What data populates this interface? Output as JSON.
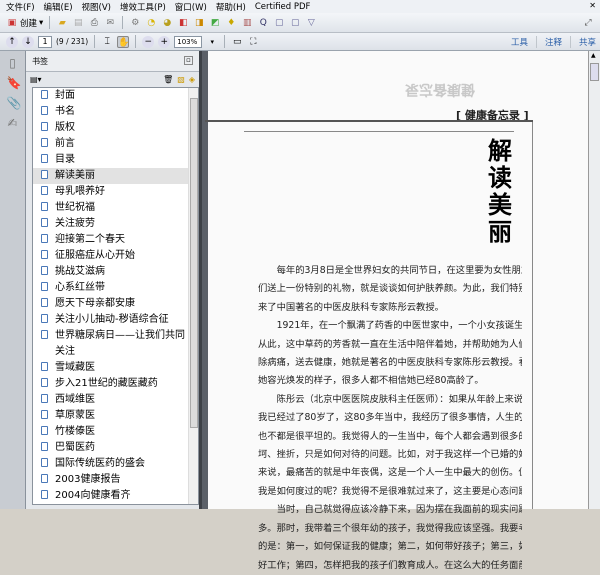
{
  "menu": [
    "文件(F)",
    "编辑(E)",
    "视图(V)",
    "增效工具(P)",
    "窗口(W)",
    "帮助(H)",
    "Certified PDF"
  ],
  "toolbar": {
    "create_label": "创建",
    "page_current": "1",
    "page_count": "(9 / 231)",
    "zoom": "103%",
    "links": [
      "工具",
      "注释",
      "共享"
    ]
  },
  "panel": {
    "title": "书签"
  },
  "bookmarks": [
    "封面",
    "书名",
    "版权",
    "前言",
    "目录",
    "解读美丽",
    "母乳喂养好",
    "世纪祝福",
    "关注疲劳",
    "迎接第二个春天",
    "征服癌症从心开始",
    "挑战艾滋病",
    "心系红丝带",
    "愿天下母亲都安康",
    "关注小儿抽动-秽语综合征",
    "世界糖尿病日——让我们共同关注",
    "雪域藏医",
    "步入21世纪的藏医藏药",
    "西域维医",
    "草原蒙医",
    "竹楼傣医",
    "巴蜀医药",
    "国际传统医药的盛会",
    "2003健康报告",
    "2004向健康看齐"
  ],
  "selected_bookmark": "解读美丽",
  "document": {
    "ghost_heading": "健康备忘录",
    "section": "[ 健康备忘录 ]",
    "title": "解读美丽",
    "lines": [
      "　　每年的3月8日是全世界妇女的共同节日，在这里要为女性朋友",
      "们送上一份特别的礼物，就是谈谈如何护肤养颜。为此，我们特别请",
      "来了中国著名的中医皮肤科专家陈彤云教授。",
      "　　1921年，在一个飘满了药香的中医世家中，一个小女孩诞生了。",
      "从此，这中草药的芳香就一直在生活中陪伴着她，并帮助她为人们解",
      "除病痛，送去健康，她就是著名的中医皮肤科专家陈彤云教授。看着",
      "她容光焕发的样子，很多人都不相信她已经80高龄了。",
      "　　陈彤云（北京中医医院皮肤科主任医师）：如果从年龄上来说，",
      "我已经过了80岁了，这80多年当中，我经历了很多事情，人生的路",
      "也不都是很平坦的。我觉得人的一生当中，每个人都会遇到很多的坎",
      "坷、挫折，只是如何对待的问题。比如，对于我这样一个已婚的妇女",
      "来说，最痛苦的就是中年丧偶，这是一个人一生中最大的创伤。但是，",
      "我是如何度过的呢？我觉得不是很难就过来了，这主要是心态问题。",
      "　　当时，自己就觉得应该冷静下来，因为摆在我面前的现实问题很",
      "多。那时，我带着三个很年幼的孩子，我觉得我应该坚强。我要考虑",
      "的是：第一，如何保证我的健康；第二，如何带好孩子；第三，如何做",
      "好工作；第四，怎样把我的孩子们教育成人。在这么大的任务面前，我"
    ]
  }
}
